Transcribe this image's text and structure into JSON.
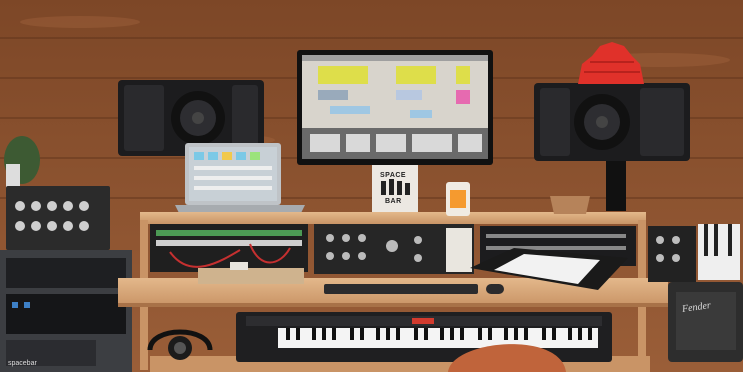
{
  "photo": {
    "stand_text_top": "SPACE",
    "stand_text_bottom": "BAR",
    "rack_label": "spacebar",
    "amp_brand": "Fender",
    "colors": {
      "wood_wall": "#8a5130",
      "desk": "#d9a878",
      "speaker": "#1c1c1e",
      "monitor_screen": "#d8d4cc",
      "red_hat": "#e0312a",
      "push_pads": "#f2f2f2"
    }
  }
}
